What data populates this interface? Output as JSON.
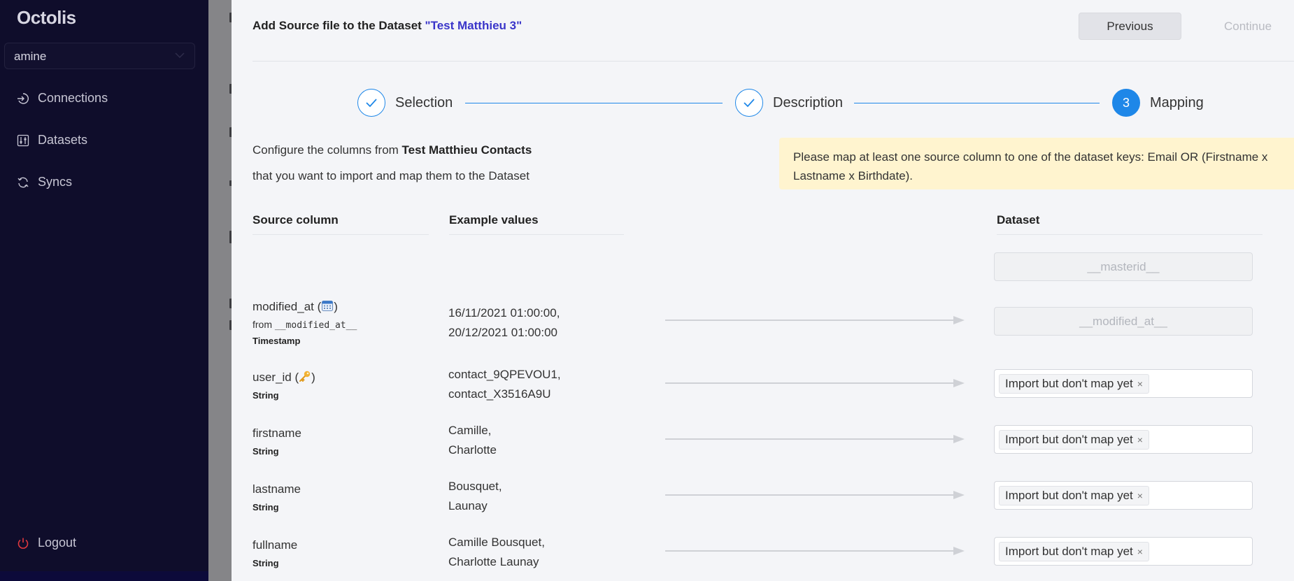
{
  "sidebar": {
    "logo": "Octolis",
    "workspace": "amine",
    "nav": [
      {
        "label": "Connections",
        "icon": "login-icon"
      },
      {
        "label": "Datasets",
        "icon": "sliders-icon"
      },
      {
        "label": "Syncs",
        "icon": "sync-icon"
      }
    ],
    "logout": "Logout"
  },
  "modal": {
    "title_prefix": "Add Source file to the Dataset ",
    "dataset_name": "\"Test Matthieu 3\"",
    "previous_label": "Previous",
    "continue_label": "Continue"
  },
  "steps": [
    {
      "label": "Selection",
      "state": "done"
    },
    {
      "label": "Description",
      "state": "done"
    },
    {
      "label": "Mapping",
      "number": "3",
      "state": "active"
    }
  ],
  "intro": {
    "line1_prefix": "Configure the columns from ",
    "source_name": "Test Matthieu Contacts",
    "line2": "that you want to import and map them to the Dataset"
  },
  "alert": {
    "text": "Please map at least one source column to one of the dataset keys: Email OR (Firstname x Lastname x Birthdate)."
  },
  "table": {
    "headers": {
      "source": "Source column",
      "examples": "Example values",
      "dataset": "Dataset"
    },
    "masterid_placeholder": "__masterid__",
    "rows": [
      {
        "name": "modified_at (",
        "name_close": ")",
        "icon": "calendar-icon",
        "from_prefix": "from ",
        "from_field": "__modified_at__",
        "type": "Timestamp",
        "examples": [
          "16/11/2021 01:00:00,",
          "20/12/2021 01:00:00"
        ],
        "target_placeholder": "__modified_at__"
      },
      {
        "name": "user_id (",
        "name_close": ")",
        "icon": "key-icon",
        "type": "String",
        "examples": [
          "contact_9QPEVOU1,",
          "contact_X3516A9U"
        ],
        "tag": "Import but don't map yet"
      },
      {
        "name": "firstname",
        "type": "String",
        "examples": [
          "Camille,",
          "Charlotte"
        ],
        "tag": "Import but don't map yet"
      },
      {
        "name": "lastname",
        "type": "String",
        "examples": [
          "Bousquet,",
          "Launay"
        ],
        "tag": "Import but don't map yet"
      },
      {
        "name": "fullname",
        "type": "String",
        "examples": [
          "Camille Bousquet,",
          "Charlotte Launay"
        ],
        "tag": "Import but don't map yet"
      }
    ],
    "tag_remove_glyph": "×"
  },
  "colors": {
    "sidebar_bg": "#0f0d2b",
    "accent": "#1e87e8",
    "dataset_name": "#3a35c9",
    "alert_bg": "#fff4cf",
    "logout_icon": "#e0383e"
  }
}
